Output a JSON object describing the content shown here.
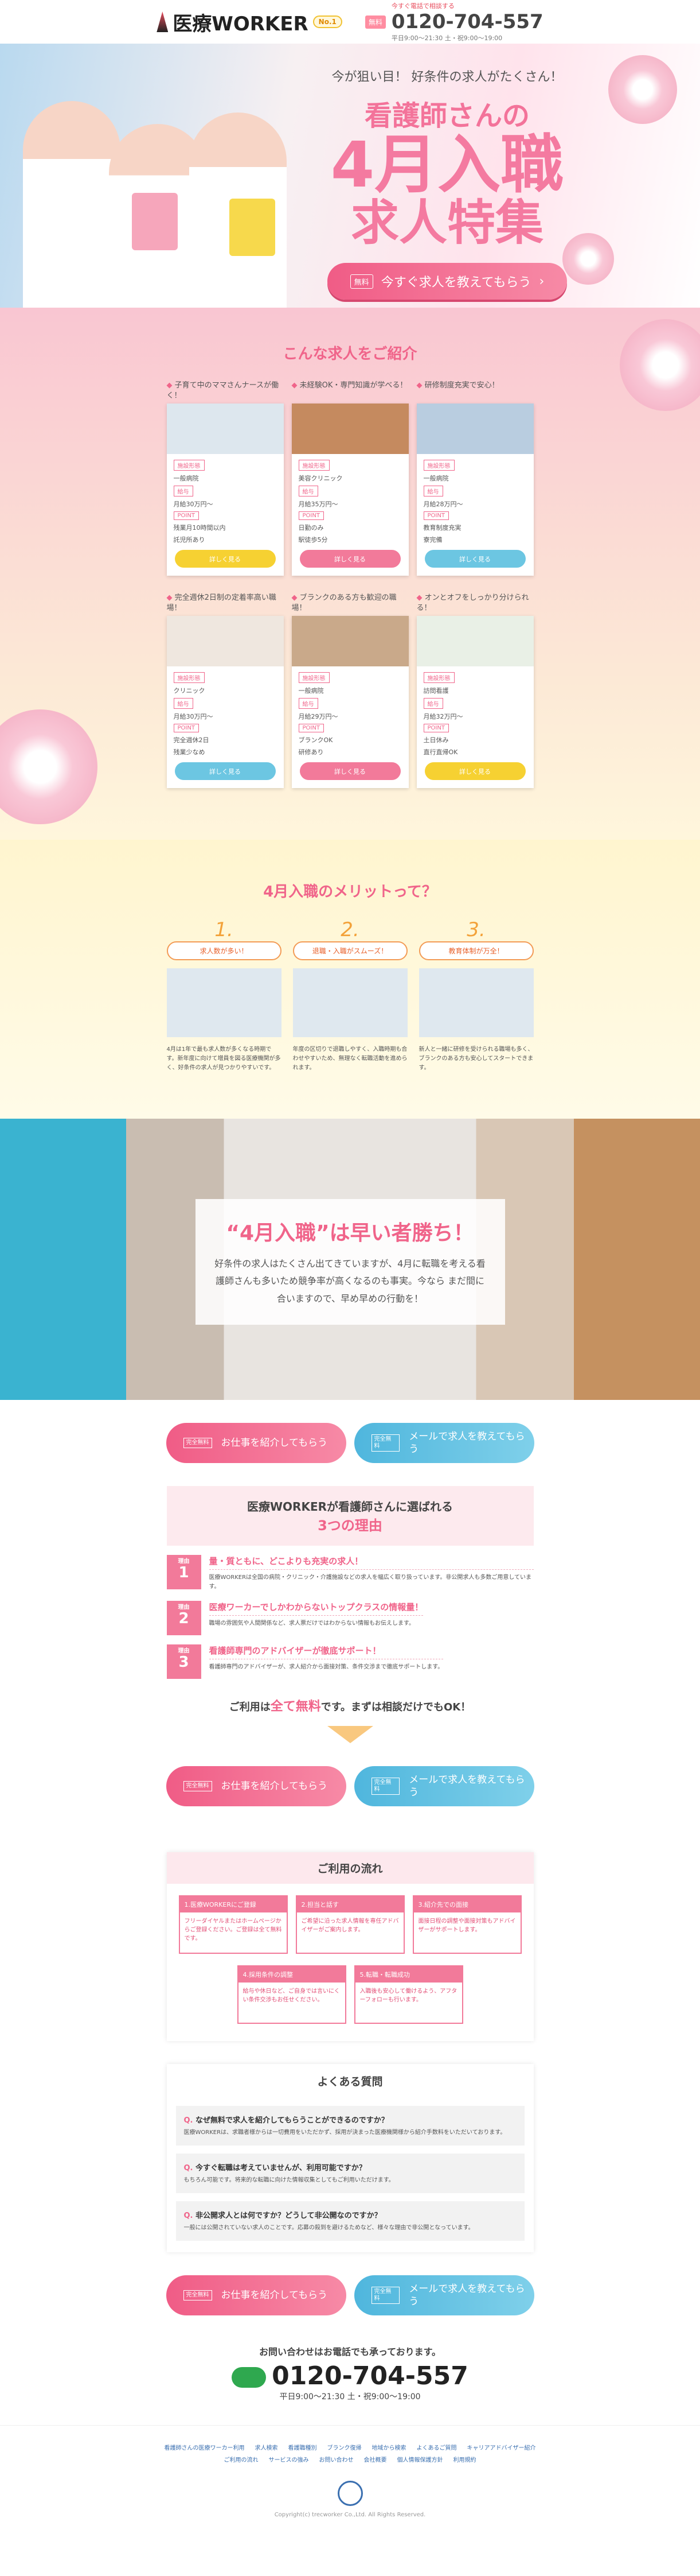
{
  "header": {
    "logo": "医療WORKER",
    "badge": "No.1",
    "free_tag": "無料",
    "catch": "今すぐ電話で相談する",
    "tel": "0120-704-557",
    "hours": "平日9:00〜21:30 土・祝9:00〜19:00"
  },
  "hero": {
    "sub": "今が狙い目！ 好条件の求人がたくさん！",
    "title1": "看護師さんの",
    "title2": "4月入職",
    "title3": "求人特集",
    "cta_tag": "無料",
    "cta_label": "今すぐ求人を教えてもらう"
  },
  "jobs": {
    "title": "こんな求人をご紹介",
    "items": [
      {
        "cat": "子育て中のママさんナースが働く！",
        "tag": "施設形態",
        "type": "一般病院",
        "salary_tag": "給与",
        "salary": "月給30万円〜",
        "point_tag": "POINT",
        "p1": "残業月10時間以内",
        "p2": "託児所あり",
        "btn": "詳しく見る",
        "color": "y"
      },
      {
        "cat": "未経験OK・専門知識が学べる！",
        "tag": "施設形態",
        "type": "美容クリニック",
        "salary_tag": "給与",
        "salary": "月給35万円〜",
        "point_tag": "POINT",
        "p1": "日勤のみ",
        "p2": "駅徒歩5分",
        "btn": "詳しく見る",
        "color": "p"
      },
      {
        "cat": "研修制度充実で安心！",
        "tag": "施設形態",
        "type": "一般病院",
        "salary_tag": "給与",
        "salary": "月給28万円〜",
        "point_tag": "POINT",
        "p1": "教育制度充実",
        "p2": "寮完備",
        "btn": "詳しく見る",
        "color": "b"
      },
      {
        "cat": "完全週休2日制の定着率高い職場！",
        "tag": "施設形態",
        "type": "クリニック",
        "salary_tag": "給与",
        "salary": "月給30万円〜",
        "point_tag": "POINT",
        "p1": "完全週休2日",
        "p2": "残業少なめ",
        "btn": "詳しく見る",
        "color": "b"
      },
      {
        "cat": "ブランクのある方も歓迎の職場！",
        "tag": "施設形態",
        "type": "一般病院",
        "salary_tag": "給与",
        "salary": "月給29万円〜",
        "point_tag": "POINT",
        "p1": "ブランクOK",
        "p2": "研修あり",
        "btn": "詳しく見る",
        "color": "p"
      },
      {
        "cat": "オンとオフをしっかり分けられる！",
        "tag": "施設形態",
        "type": "訪問看護",
        "salary_tag": "給与",
        "salary": "月給32万円〜",
        "point_tag": "POINT",
        "p1": "土日休み",
        "p2": "直行直帰OK",
        "btn": "詳しく見る",
        "color": "y"
      }
    ]
  },
  "merit": {
    "title": "4月入職のメリットって？",
    "items": [
      {
        "num": "1.",
        "head": "求人数が多い！",
        "text": "4月は1年で最も求人数が多くなる時期です。新年度に向けて増員を図る医療機関が多く、好条件の求人が見つかりやすいです。"
      },
      {
        "num": "2.",
        "head": "退職・入職がスムーズ！",
        "text": "年度の区切りで退職しやすく、入職時期も合わせやすいため、無理なく転職活動を進められます。"
      },
      {
        "num": "3.",
        "head": "教育体制が万全！",
        "text": "新人と一緒に研修を受けられる職場も多く、ブランクのある方も安心してスタートできます。"
      }
    ]
  },
  "banner": {
    "head": "“4月入職”は早い者勝ち！",
    "text": "好条件の求人はたくさん出てきていますが、4月に転職を考える看護師さんも多いため競争率が高くなるのも事実。今なら まだ間に合いますので、早め早めの行動を！"
  },
  "cta": {
    "tag": "完全無料",
    "left": "お仕事を紹介してもらう",
    "right": "メールで求人を教えてもらう"
  },
  "reasons": {
    "title_pre": "医療WORKERが看護師さんに選ばれる",
    "title_num": "3つの理由",
    "items": [
      {
        "label": "理由",
        "num": "1",
        "head": "量・質ともに、どこよりも充実の求人！",
        "text": "医療WORKERは全国の病院・クリニック・介護施設などの求人を幅広く取り扱っています。非公開求人も多数ご用意しています。"
      },
      {
        "label": "理由",
        "num": "2",
        "head": "医療ワーカーでしかわからないトップクラスの情報量！",
        "text": "職場の雰囲気や人間関係など、求人票だけではわからない情報もお伝えします。"
      },
      {
        "label": "理由",
        "num": "3",
        "head": "看護師専門のアドバイザーが徹底サポート！",
        "text": "看護師専門のアドバイザーが、求人紹介から面接対策、条件交渉まで徹底サポートします。"
      }
    ],
    "free_pre": "ご利用は",
    "free_em": "全て無料",
    "free_post": "です。まずは相談だけでもOK！"
  },
  "flow": {
    "title": "ご利用の流れ",
    "steps": [
      {
        "head": "1.医療WORKERにご登録",
        "text": "フリーダイヤルまたはホームページからご登録ください。ご登録は全て無料です。"
      },
      {
        "head": "2.担当と話す",
        "text": "ご希望に沿った求人情報を専任アドバイザーがご案内します。"
      },
      {
        "head": "3.紹介先での面接",
        "text": "面接日程の調整や面接対策もアドバイザーがサポートします。"
      },
      {
        "head": "4.採用条件の調整",
        "text": "給与や休日など、ご自身では言いにくい条件交渉もお任せください。"
      },
      {
        "head": "5.転職・転職成功",
        "text": "入職後も安心して働けるよう、アフターフォローも行います。"
      }
    ]
  },
  "faq": {
    "title": "よくある質問",
    "items": [
      {
        "q": "なぜ無料で求人を紹介してもらうことができるのですか？",
        "a": "医療WORKERは、求職者様からは一切費用をいただかず、採用が決まった医療機関様から紹介手数料をいただいております。"
      },
      {
        "q": "今すぐ転職は考えていませんが、利用可能ですか？",
        "a": "もちろん可能です。将来的な転職に向けた情報収集としてもご利用いただけます。"
      },
      {
        "q": "非公開求人とは何ですか？どうして非公開なのですか？",
        "a": "一般には公開されていない求人のことです。応募の殺到を避けるためなど、様々な理由で非公開となっています。"
      }
    ]
  },
  "contact": {
    "lead": "お問い合わせはお電話でも承っております。",
    "tel": "0120-704-557",
    "hours": "平日9:00〜21:30 土・祝9:00〜19:00"
  },
  "footer": {
    "links": [
      "看護師さんの医療ワーカー利用",
      "求人検索",
      "看護職種別",
      "ブランク復帰",
      "地域から検索",
      "よくあるご質問",
      "キャリアアドバイザー紹介",
      "ご利用の流れ",
      "サービスの強み",
      "お問い合わせ",
      "会社概要",
      "個人情報保護方針",
      "利用規約"
    ],
    "copy": "Copyright(c) trecworker Co.,Ltd. All Rights Reserved."
  }
}
